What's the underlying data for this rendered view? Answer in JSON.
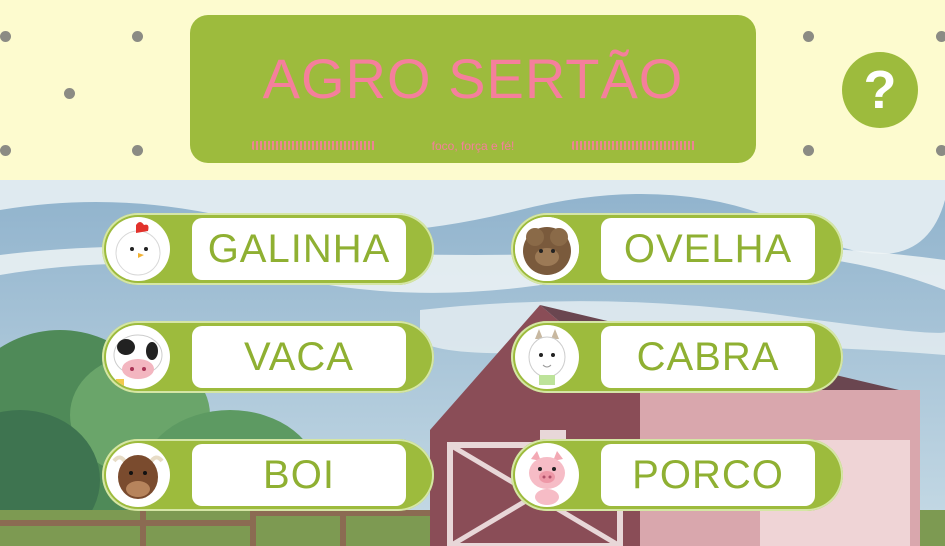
{
  "header": {
    "title": "AGRO SERTÃO",
    "subtitle": "foco, força e fé!",
    "help_label": "?"
  },
  "colors": {
    "panel_green": "#9dbb3d",
    "title_pink": "#f57f9c",
    "header_bg": "#fdfbcf"
  },
  "animals": [
    {
      "label": "GALINHA",
      "icon": "chicken-icon"
    },
    {
      "label": "OVELHA",
      "icon": "sheep-icon"
    },
    {
      "label": "VACA",
      "icon": "cow-icon"
    },
    {
      "label": "CABRA",
      "icon": "goat-icon"
    },
    {
      "label": "BOI",
      "icon": "ox-icon"
    },
    {
      "label": "PORCO",
      "icon": "pig-icon"
    }
  ]
}
